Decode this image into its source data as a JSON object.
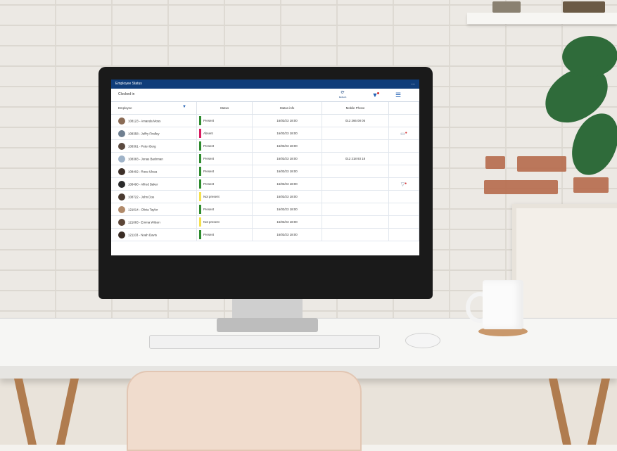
{
  "app": {
    "title": "Employee Status",
    "filter_value": "Clocked in",
    "refresh_label": "Refresh",
    "menu_dots": "...",
    "icons": {
      "refresh": "refresh-icon",
      "filter": "filter-icon",
      "menu": "menu-icon",
      "sort": "sort-icon"
    },
    "colors": {
      "titlebar": "#0f3d7a",
      "present": "#2e8b2e",
      "absent": "#d81b60",
      "not_present": "#f4e04d"
    }
  },
  "table": {
    "headers": {
      "employee": "Employee",
      "status": "Status",
      "status_info": "Status info",
      "mobile_phone": "Mobile Phone"
    },
    "rows": [
      {
        "employee": "108123 - Amanda Moss",
        "status": "Present",
        "status_kind": "present",
        "status_info": "16/03/23 18:00",
        "mobile_phone": "012 266 08 05",
        "action": ""
      },
      {
        "employee": "108358 - Jeffry Findley",
        "status": "Absent",
        "status_kind": "absent",
        "status_info": "16/03/23 18:00",
        "mobile_phone": "",
        "action": "comment-icon"
      },
      {
        "employee": "108361 - Peter Berg",
        "status": "Present",
        "status_kind": "present",
        "status_info": "16/03/23 18:00",
        "mobile_phone": "",
        "action": ""
      },
      {
        "employee": "108383 - Jonas Backman",
        "status": "Present",
        "status_kind": "present",
        "status_info": "16/03/23 18:00",
        "mobile_phone": "012 218 93 18",
        "action": ""
      },
      {
        "employee": "108402 - Rose Ulsea",
        "status": "Present",
        "status_kind": "present",
        "status_info": "16/03/23 18:00",
        "mobile_phone": "",
        "action": ""
      },
      {
        "employee": "108490 - Alfred Baker",
        "status": "Present",
        "status_kind": "present",
        "status_info": "16/03/23 18:00",
        "mobile_phone": "",
        "action": "filter-alert-icon"
      },
      {
        "employee": "108722 - John Doe",
        "status": "Not present",
        "status_kind": "not_present",
        "status_info": "16/03/23 18:00",
        "mobile_phone": "",
        "action": ""
      },
      {
        "employee": "121014 - Olivia Taylor",
        "status": "Present",
        "status_kind": "present",
        "status_info": "16/03/23 18:00",
        "mobile_phone": "",
        "action": ""
      },
      {
        "employee": "121083 - Emma Wilson",
        "status": "Not present",
        "status_kind": "not_present",
        "status_info": "16/03/23 18:00",
        "mobile_phone": "",
        "action": ""
      },
      {
        "employee": "121103 - Noah Davis",
        "status": "Present",
        "status_kind": "present",
        "status_info": "16/03/23 18:00",
        "mobile_phone": "",
        "action": ""
      }
    ]
  }
}
